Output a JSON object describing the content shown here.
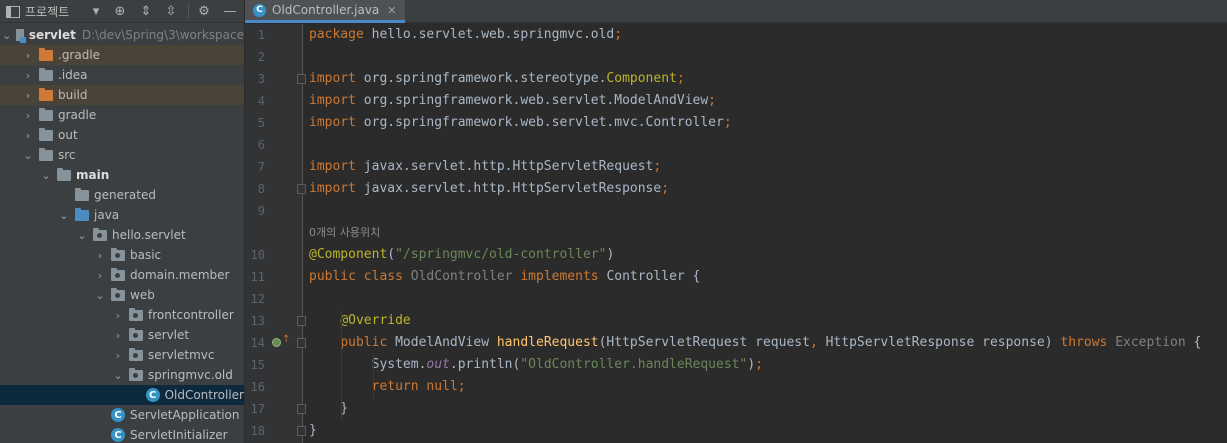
{
  "project_panel": {
    "title": "프로젝트",
    "tree": [
      {
        "label": "servlet",
        "path": "D:\\dev\\Spring\\3\\workspace",
        "depth": 0,
        "icon": "module",
        "expanded": true,
        "bold": true
      },
      {
        "label": ".gradle",
        "depth": 1,
        "icon": "folder-orange",
        "expanded": false,
        "highlight": true
      },
      {
        "label": ".idea",
        "depth": 1,
        "icon": "folder",
        "expanded": false
      },
      {
        "label": "build",
        "depth": 1,
        "icon": "folder-orange",
        "expanded": false,
        "highlight": true
      },
      {
        "label": "gradle",
        "depth": 1,
        "icon": "folder",
        "expanded": false
      },
      {
        "label": "out",
        "depth": 1,
        "icon": "folder",
        "expanded": false
      },
      {
        "label": "src",
        "depth": 1,
        "icon": "folder",
        "expanded": true
      },
      {
        "label": "main",
        "depth": 2,
        "icon": "folder",
        "expanded": true,
        "bold": true
      },
      {
        "label": "generated",
        "depth": 3,
        "icon": "folder",
        "leaf": true
      },
      {
        "label": "java",
        "depth": 3,
        "icon": "folder-blue",
        "expanded": true
      },
      {
        "label": "hello.servlet",
        "depth": 4,
        "icon": "package",
        "expanded": true
      },
      {
        "label": "basic",
        "depth": 5,
        "icon": "package",
        "expanded": false
      },
      {
        "label": "domain.member",
        "depth": 5,
        "icon": "package",
        "expanded": false
      },
      {
        "label": "web",
        "depth": 5,
        "icon": "package",
        "expanded": true
      },
      {
        "label": "frontcontroller",
        "depth": 6,
        "icon": "package",
        "expanded": false
      },
      {
        "label": "servlet",
        "depth": 6,
        "icon": "package",
        "expanded": false
      },
      {
        "label": "servletmvc",
        "depth": 6,
        "icon": "package",
        "expanded": false
      },
      {
        "label": "springmvc.old",
        "depth": 6,
        "icon": "package",
        "expanded": true
      },
      {
        "label": "OldController",
        "depth": 7,
        "icon": "class",
        "leaf": true,
        "selected": true
      },
      {
        "label": "ServletApplication",
        "depth": 5,
        "icon": "class",
        "leaf": true
      },
      {
        "label": "ServletInitializer",
        "depth": 5,
        "icon": "class",
        "leaf": true
      }
    ]
  },
  "editor": {
    "tab_label": "OldController.java",
    "usage_hint": "0개의 사용위치",
    "lines": [
      {
        "n": "1",
        "text": "package hello.servlet.web.springmvc.old;"
      },
      {
        "n": "2",
        "text": ""
      },
      {
        "n": "3",
        "text": "import org.springframework.stereotype.Component;"
      },
      {
        "n": "4",
        "text": "import org.springframework.web.servlet.ModelAndView;"
      },
      {
        "n": "5",
        "text": "import org.springframework.web.servlet.mvc.Controller;"
      },
      {
        "n": "6",
        "text": ""
      },
      {
        "n": "7",
        "text": "import javax.servlet.http.HttpServletRequest;"
      },
      {
        "n": "8",
        "text": "import javax.servlet.http.HttpServletResponse;"
      },
      {
        "n": "9",
        "text": ""
      },
      {
        "n": "10",
        "text": "@Component(\"/springmvc/old-controller\")"
      },
      {
        "n": "11",
        "text": "public class OldController implements Controller {"
      },
      {
        "n": "12",
        "text": ""
      },
      {
        "n": "13",
        "text": "    @Override"
      },
      {
        "n": "14",
        "text": "    public ModelAndView handleRequest(HttpServletRequest request, HttpServletResponse response) throws Exception {"
      },
      {
        "n": "15",
        "text": "        System.out.println(\"OldController.handleRequest\");"
      },
      {
        "n": "16",
        "text": "        return null;"
      },
      {
        "n": "17",
        "text": "    }"
      },
      {
        "n": "18",
        "text": "}"
      }
    ]
  },
  "colors": {
    "keyword": "#cc7832",
    "annotation": "#bbb529",
    "string": "#6a8759",
    "method": "#ffc66d",
    "plain": "#a9b7c6",
    "selection": "#0d293e",
    "excluded_folder_bg": "#4a4337"
  }
}
